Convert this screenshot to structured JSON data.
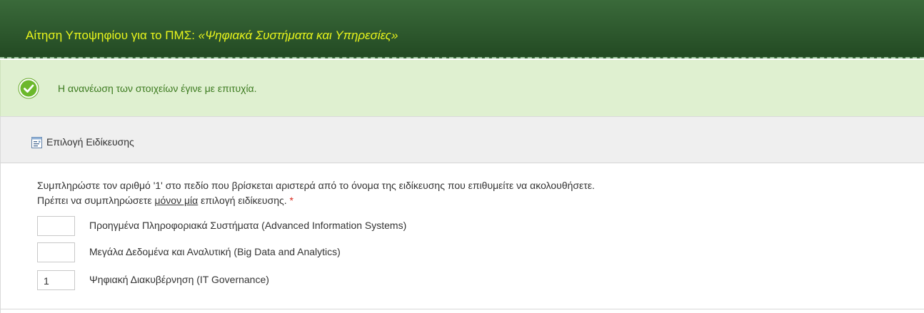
{
  "header": {
    "title_prefix": "Αίτηση Υποψηφίου για το ΠΜΣ: ",
    "title_program": "«Ψηφιακά Συστήματα και Υπηρεσίες»"
  },
  "alert": {
    "icon": "check-circle-icon",
    "message": "Η ανανέωση των στοιχείων έγινε με επιτυχία."
  },
  "section": {
    "icon": "document-list-icon",
    "title": "Επιλογή Ειδίκευσης"
  },
  "instructions": {
    "line1": "Συμπληρώστε τον αριθμό '1' στο πεδίο που βρίσκεται αριστερά από το όνομα της ειδίκευσης που επιθυμείτε να ακολουθήσετε.",
    "line2_before": "Πρέπει να συμπληρώσετε ",
    "line2_emphasis": "μόνον μία",
    "line2_after": " επιλογή ειδίκευσης. ",
    "required_mark": "*"
  },
  "options": [
    {
      "value": "",
      "label": "Προηγμένα Πληροφοριακά Συστήματα (Advanced Information Systems)"
    },
    {
      "value": "",
      "label": "Μεγάλα Δεδομένα και Αναλυτική (Big Data and Analytics)"
    },
    {
      "value": "1",
      "label": "Ψηφιακή Διακυβέρνηση (IT Governance)"
    }
  ],
  "colors": {
    "header_bg": "#2e5c2e",
    "header_text": "#e9f51c",
    "success_bg": "#dff0d0",
    "success_text": "#3c7a1f",
    "required": "#d9281c"
  }
}
